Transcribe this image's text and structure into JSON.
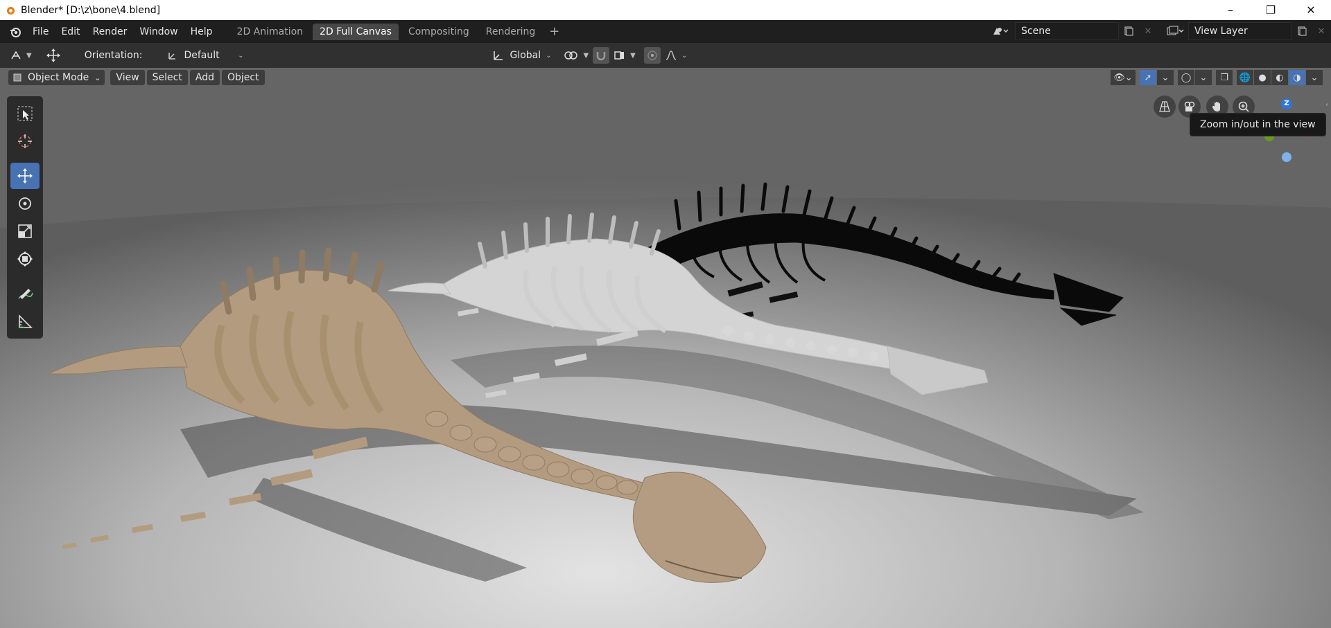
{
  "window": {
    "title": "Blender* [D:\\z\\bone\\4.blend]"
  },
  "menu": [
    "File",
    "Edit",
    "Render",
    "Window",
    "Help"
  ],
  "workspaces": [
    "2D Animation",
    "2D Full Canvas",
    "Compositing",
    "Rendering"
  ],
  "active_workspace": "2D Full Canvas",
  "scene": {
    "name": "Scene"
  },
  "view_layer": {
    "name": "View Layer"
  },
  "tool_settings": {
    "orientation_label": "Orientation:",
    "orientation_value": "Default",
    "transform_orientation": "Global"
  },
  "viewport_header": {
    "mode": "Object Mode",
    "view": "View",
    "select": "Select",
    "add": "Add",
    "object": "Object"
  },
  "tooltip": "Zoom in/out in the view",
  "gizmo": {
    "z_label": "Z"
  },
  "colors": {
    "accent": "#4772b3",
    "bone_tan": "#b39b80",
    "bone_white": "#d4d4d4",
    "bone_black": "#0a0a0a"
  }
}
